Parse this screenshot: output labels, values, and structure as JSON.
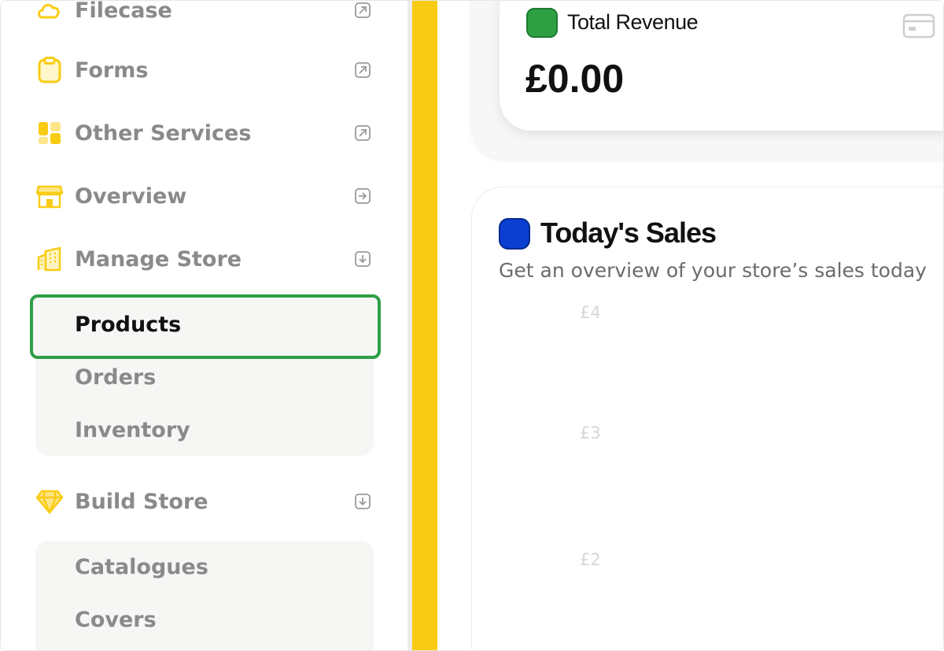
{
  "sidebar": {
    "items": [
      {
        "label": "Filecase",
        "icon": "cloud-icon",
        "trail": "external-link-icon"
      },
      {
        "label": "Forms",
        "icon": "clipboard-icon",
        "trail": "external-link-icon"
      },
      {
        "label": "Other Services",
        "icon": "grid-icon",
        "trail": "external-link-icon"
      },
      {
        "label": "Overview",
        "icon": "storefront-icon",
        "trail": "arrow-right-box-icon"
      },
      {
        "label": "Manage Store",
        "icon": "buildings-icon",
        "trail": "arrow-down-box-icon"
      },
      {
        "label": "Build Store",
        "icon": "diamond-icon",
        "trail": "arrow-down-box-icon"
      }
    ],
    "manage_store_sub": {
      "products": "Products",
      "orders": "Orders",
      "inventory": "Inventory"
    },
    "build_store_sub": {
      "catalogues": "Catalogues",
      "covers": "Covers"
    },
    "accent_color": "#f9cc14",
    "highlight_color": "#2f9f45"
  },
  "revenue": {
    "title": "Total Revenue",
    "value": "£0.00",
    "icon_color": "#2ea043"
  },
  "sales": {
    "title": "Today's Sales",
    "subtitle": "Get an overview of your store’s sales today",
    "icon_color": "#0a3fd1",
    "y_ticks": [
      "£4",
      "£3",
      "£2"
    ]
  }
}
